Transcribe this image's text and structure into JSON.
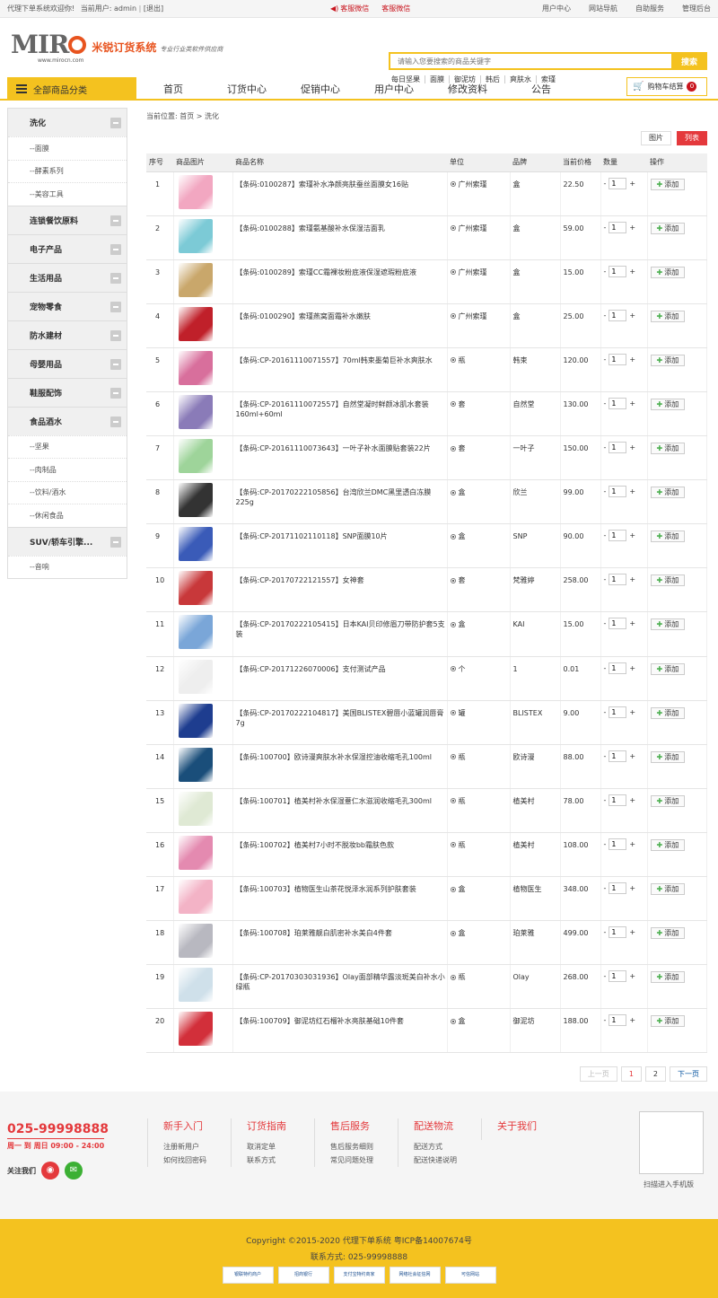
{
  "topbar": {
    "welcome": "代理下单系统欢迎你!",
    "user_prefix": "当前用户:",
    "username": "admin",
    "logout": "[退出]",
    "service1": "客服微信",
    "service2": "客服微信",
    "links": [
      "用户中心",
      "网站导航",
      "自助服务",
      "管理后台"
    ]
  },
  "logo": {
    "brand": "MIRO",
    "url": "www.mirocn.com",
    "cn_name": "米锐订货系统",
    "slogan": "专业行业类软件供应商"
  },
  "search": {
    "placeholder": "请输入您要搜索的商品关键字",
    "button": "搜索",
    "hot": [
      "每日坚果",
      "面膜",
      "御泥坊",
      "韩后",
      "爽肤水",
      "索瑾"
    ]
  },
  "nav": {
    "all_categories": "全部商品分类",
    "links": [
      "首页",
      "订货中心",
      "促销中心",
      "用户中心",
      "修改资料",
      "公告"
    ],
    "cart_label": "购物车结算",
    "cart_count": "0"
  },
  "sidebar": [
    {
      "name": "洗化",
      "subs": [
        "--面膜",
        "--酵素系列",
        "--美容工具"
      ]
    },
    {
      "name": "连锁餐饮原料",
      "subs": []
    },
    {
      "name": "电子产品",
      "subs": []
    },
    {
      "name": "生活用品",
      "subs": []
    },
    {
      "name": "宠物零食",
      "subs": []
    },
    {
      "name": "防水建材",
      "subs": []
    },
    {
      "name": "母婴用品",
      "subs": []
    },
    {
      "name": "鞋服配饰",
      "subs": []
    },
    {
      "name": "食品酒水",
      "subs": [
        "--坚果",
        "--肉制品",
        "--饮料/酒水",
        "--休闲食品"
      ]
    },
    {
      "name": "SUV/轿车引擎...",
      "subs": [
        "--音响"
      ]
    }
  ],
  "breadcrumb": {
    "prefix": "当前位置:",
    "home": "首页",
    "sep": " > ",
    "current": "洗化"
  },
  "view": {
    "image": "图片",
    "list": "列表"
  },
  "table": {
    "headers": [
      "序号",
      "商品图片",
      "商品名称",
      "单位",
      "品牌",
      "当前价格",
      "数量",
      "操作"
    ],
    "add_label": "添加",
    "qty_default": "1",
    "rows": [
      {
        "no": "1",
        "name": "【条码:0100287】索瑾补水净颜亮肤蚕丝面膜女16贴",
        "unit": "广州索瑾",
        "brand": "盒",
        "price": "22.50",
        "color": "#f2a7c1"
      },
      {
        "no": "2",
        "name": "【条码:0100288】索瑾氨基酸补水保湿洁面乳",
        "unit": "广州索瑾",
        "brand": "盒",
        "price": "59.00",
        "color": "#7ccad6"
      },
      {
        "no": "3",
        "name": "【条码:0100289】索瑾CC霜裸妆粉底液保湿遮瑕粉底液",
        "unit": "广州索瑾",
        "brand": "盒",
        "price": "15.00",
        "color": "#c9a76b"
      },
      {
        "no": "4",
        "name": "【条码:0100290】索瑾燕窝面霜补水嫩肤",
        "unit": "广州索瑾",
        "brand": "盒",
        "price": "25.00",
        "color": "#c0202a"
      },
      {
        "no": "5",
        "name": "【条码:CP-20161110071557】70ml韩束墨菊巨补水爽肤水",
        "unit": "瓶",
        "brand": "韩束",
        "price": "120.00",
        "color": "#d86f9c"
      },
      {
        "no": "6",
        "name": "【条码:CP-20161110072557】自然堂凝时鲜颜冰肌水套装160ml+60ml",
        "unit": "套",
        "brand": "自然堂",
        "price": "130.00",
        "color": "#8a7bb8"
      },
      {
        "no": "7",
        "name": "【条码:CP-20161110073643】一叶子补水面膜贴套装22片",
        "unit": "套",
        "brand": "一叶子",
        "price": "150.00",
        "color": "#9ed49a"
      },
      {
        "no": "8",
        "name": "【条码:CP-20170222105856】台湾欣兰DMC黑里透白冻膜225g",
        "unit": "盒",
        "brand": "欣兰",
        "price": "99.00",
        "color": "#333333"
      },
      {
        "no": "9",
        "name": "【条码:CP-20171102110118】SNP面膜10片",
        "unit": "盒",
        "brand": "SNP",
        "price": "90.00",
        "color": "#3a5bb8"
      },
      {
        "no": "10",
        "name": "【条码:CP-20170722121557】女神套",
        "unit": "套",
        "brand": "梵雅婷",
        "price": "258.00",
        "color": "#c8383a"
      },
      {
        "no": "11",
        "name": "【条码:CP-20170222105415】日本KAI贝印修眉刀带防护套5支装",
        "unit": "盒",
        "brand": "KAI",
        "price": "15.00",
        "color": "#7aa6d8"
      },
      {
        "no": "12",
        "name": "【条码:CP-20171226070006】支付测试产品",
        "unit": "个",
        "brand": "1",
        "price": "0.01",
        "color": "#eeeeee"
      },
      {
        "no": "13",
        "name": "【条码:CP-20170222104817】美国BLISTEX碧唇小蓝罐润唇膏7g",
        "unit": "罐",
        "brand": "BLISTEX",
        "price": "9.00",
        "color": "#1e3d8f"
      },
      {
        "no": "14",
        "name": "【条码:100700】欧诗漫爽肤水补水保湿控油收缩毛孔100ml",
        "unit": "瓶",
        "brand": "欧诗漫",
        "price": "88.00",
        "color": "#1a4e7a"
      },
      {
        "no": "15",
        "name": "【条码:100701】植美村补水保湿薏仁水滋润收缩毛孔300ml",
        "unit": "瓶",
        "brand": "植美村",
        "price": "78.00",
        "color": "#dfe9d4"
      },
      {
        "no": "16",
        "name": "【条码:100702】植美村7小时不脱妆bb霜肤色款",
        "unit": "瓶",
        "brand": "植美村",
        "price": "108.00",
        "color": "#e48ab0"
      },
      {
        "no": "17",
        "name": "【条码:100703】植物医生山茶花悦泽水润系列护肤套装",
        "unit": "盒",
        "brand": "植物医生",
        "price": "348.00",
        "color": "#f3b3c6"
      },
      {
        "no": "18",
        "name": "【条码:100708】珀莱雅靓白肌密补水美白4件套",
        "unit": "盒",
        "brand": "珀莱雅",
        "price": "499.00",
        "color": "#b8b8c0"
      },
      {
        "no": "19",
        "name": "【条码:CP-20170303031936】Olay面部精华露淡斑美白补水小绿瓶",
        "unit": "瓶",
        "brand": "Olay",
        "price": "268.00",
        "color": "#cfe0ea"
      },
      {
        "no": "20",
        "name": "【条码:100709】御泥坊红石榴补水亮肤基础10件套",
        "unit": "盒",
        "brand": "御泥坊",
        "price": "188.00",
        "color": "#d22f3a"
      }
    ]
  },
  "pager": {
    "prev": "上一页",
    "pages": [
      "1",
      "2"
    ],
    "next": "下一页"
  },
  "footer": {
    "tel": "025-99998888",
    "hours": "周一 到 周日 09:00 - 24:00",
    "follow": "关注我们",
    "cols": [
      {
        "title": "新手入门",
        "links": [
          "注册新用户",
          "如何找回密码"
        ]
      },
      {
        "title": "订货指南",
        "links": [
          "取消定单",
          "联系方式"
        ]
      },
      {
        "title": "售后服务",
        "links": [
          "售后服务细则",
          "常见问题处理"
        ]
      },
      {
        "title": "配送物流",
        "links": [
          "配送方式",
          "配送快递说明"
        ]
      },
      {
        "title": "关于我们",
        "links": []
      }
    ],
    "qr_label": "扫描进入手机版"
  },
  "copyright": {
    "line1": "Copyright ©2015-2020 代理下单系统 粤ICP备14007674号",
    "line2": "联系方式: 025-99998888",
    "badges": [
      "银联特约商户",
      "招商银行",
      "支付宝特约商家",
      "网络社会征信网",
      "可信网站"
    ]
  }
}
